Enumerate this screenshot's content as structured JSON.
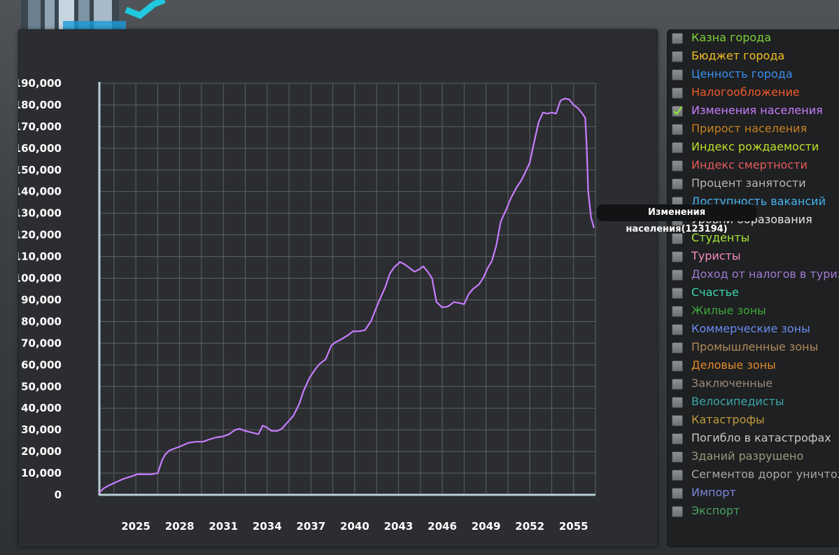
{
  "colors": {
    "line": "#c77dff",
    "grid": "#5c6166",
    "axis": "#b9cfd8",
    "check": "#8ee13a"
  },
  "legend": {
    "items": [
      {
        "label": "Казна города",
        "color": "#7ed23a",
        "checked": false
      },
      {
        "label": "Бюджет города",
        "color": "#f2c021",
        "checked": false
      },
      {
        "label": "Ценность города",
        "color": "#3a8ff0",
        "checked": false
      },
      {
        "label": "Налогообложение",
        "color": "#f05a28",
        "checked": false
      },
      {
        "label": "Изменения населения",
        "color": "#c77dff",
        "checked": true
      },
      {
        "label": "Прирост населения",
        "color": "#c8801e",
        "checked": false
      },
      {
        "label": "Индекс рождаемости",
        "color": "#bfe02a",
        "checked": false
      },
      {
        "label": "Индекс смертности",
        "color": "#e85a5a",
        "checked": false
      },
      {
        "label": "Процент занятости",
        "color": "#b5b5b5",
        "checked": false
      },
      {
        "label": "Доступность вакансий",
        "color": "#46b4f0",
        "checked": false
      },
      {
        "label": "Уровни образования",
        "color": "#e6e6e6",
        "checked": false
      },
      {
        "label": "Студенты",
        "color": "#a6e63a",
        "checked": false
      },
      {
        "label": "Туристы",
        "color": "#f58cc0",
        "checked": false
      },
      {
        "label": "Доход от налогов в туриз",
        "color": "#a07ad0",
        "checked": false
      },
      {
        "label": "Счастье",
        "color": "#3ad8b0",
        "checked": false
      },
      {
        "label": "Жилые зоны",
        "color": "#3ea83a",
        "checked": false
      },
      {
        "label": "Коммерческие зоны",
        "color": "#6a8cf0",
        "checked": false
      },
      {
        "label": "Промышленные зоны",
        "color": "#b08a5a",
        "checked": false
      },
      {
        "label": "Деловые зоны",
        "color": "#e08a28",
        "checked": false
      },
      {
        "label": "Заключенные",
        "color": "#9a8a7a",
        "checked": false
      },
      {
        "label": "Велосипедисты",
        "color": "#3aa8a8",
        "checked": false
      },
      {
        "label": "Катастрофы",
        "color": "#c09a3a",
        "checked": false
      },
      {
        "label": "Погибло в катастрофах",
        "color": "#c8c8c8",
        "checked": false
      },
      {
        "label": "Зданий разрушено",
        "color": "#9a9a7a",
        "checked": false
      },
      {
        "label": "Сегментов дорог уничтож",
        "color": "#a8a8a8",
        "checked": false
      },
      {
        "label": "Импорт",
        "color": "#7a86d8",
        "checked": false
      },
      {
        "label": "Экспорт",
        "color": "#4aa060",
        "checked": false
      }
    ]
  },
  "tooltip": {
    "text": "Изменения населения(123194)"
  },
  "chart_data": {
    "type": "line",
    "ylim": [
      0,
      190000
    ],
    "xlim": [
      2023,
      2057
    ],
    "grid": true,
    "y_ticks": [
      "0",
      "10,000",
      "20,000",
      "30,000",
      "40,000",
      "50,000",
      "60,000",
      "70,000",
      "80,000",
      "90,000",
      "100,000",
      "110,000",
      "120,000",
      "130,000",
      "140,000",
      "150,000",
      "160,000",
      "170,000",
      "180,000",
      "190,000"
    ],
    "x_ticks": [
      "2025",
      "2028",
      "2031",
      "2034",
      "2037",
      "2040",
      "2043",
      "2046",
      "2049",
      "2052",
      "2055"
    ],
    "series": [
      {
        "name": "Изменения населения",
        "x": [
          2023.0,
          2023.3,
          2023.7,
          2024.2,
          2024.7,
          2025.2,
          2025.6,
          2026.1,
          2026.6,
          2027.0,
          2027.3,
          2027.5,
          2027.8,
          2028.2,
          2028.6,
          2029.1,
          2029.6,
          2030.1,
          2030.5,
          2031.0,
          2031.5,
          2031.9,
          2032.3,
          2032.6,
          2033.0,
          2033.3,
          2033.6,
          2033.9,
          2034.2,
          2034.5,
          2034.8,
          2035.2,
          2035.5,
          2035.9,
          2036.3,
          2036.7,
          2037.0,
          2037.4,
          2037.8,
          2038.1,
          2038.5,
          2038.9,
          2039.2,
          2039.5,
          2040.0,
          2040.4,
          2040.8,
          2041.2,
          2041.6,
          2041.9,
          2042.2,
          2042.6,
          2042.9,
          2043.2,
          2043.6,
          2043.9,
          2044.3,
          2044.6,
          2044.9,
          2045.2,
          2045.5,
          2045.8,
          2046.1,
          2046.5,
          2046.9,
          2047.3,
          2047.7,
          2048.0,
          2048.3,
          2048.6,
          2049.0,
          2049.3,
          2049.6,
          2049.9,
          2050.2,
          2050.5,
          2050.9,
          2051.2,
          2051.6,
          2051.9,
          2052.2,
          2052.5,
          2052.8,
          2053.1,
          2053.4,
          2053.7,
          2054.0,
          2054.3,
          2054.6,
          2054.9,
          2055.2,
          2055.5,
          2055.8,
          2056.1,
          2056.3,
          2056.4,
          2056.5,
          2056.7,
          2056.9
        ],
        "y": [
          1000,
          3000,
          4500,
          6000,
          7500,
          8500,
          9500,
          9500,
          9500,
          10000,
          16000,
          18500,
          20500,
          21500,
          22500,
          24000,
          24500,
          24500,
          25500,
          26500,
          27000,
          28000,
          30000,
          30500,
          29500,
          29000,
          28500,
          28000,
          32000,
          31000,
          29500,
          29500,
          30500,
          33500,
          36500,
          42000,
          48000,
          54000,
          58000,
          60500,
          62500,
          69000,
          70500,
          71500,
          73500,
          75500,
          75500,
          76000,
          80000,
          85000,
          90000,
          96000,
          102000,
          105000,
          107500,
          106500,
          104500,
          103000,
          104000,
          105500,
          103000,
          100000,
          89000,
          86500,
          87000,
          89000,
          88500,
          88000,
          92500,
          95000,
          97000,
          100000,
          104500,
          108000,
          115000,
          126000,
          132000,
          137000,
          142000,
          145000,
          149000,
          153500,
          163000,
          172000,
          176500,
          176000,
          176500,
          176000,
          182000,
          183000,
          182500,
          180000,
          178500,
          176000,
          174000,
          160000,
          140000,
          128000,
          123194
        ]
      }
    ]
  }
}
